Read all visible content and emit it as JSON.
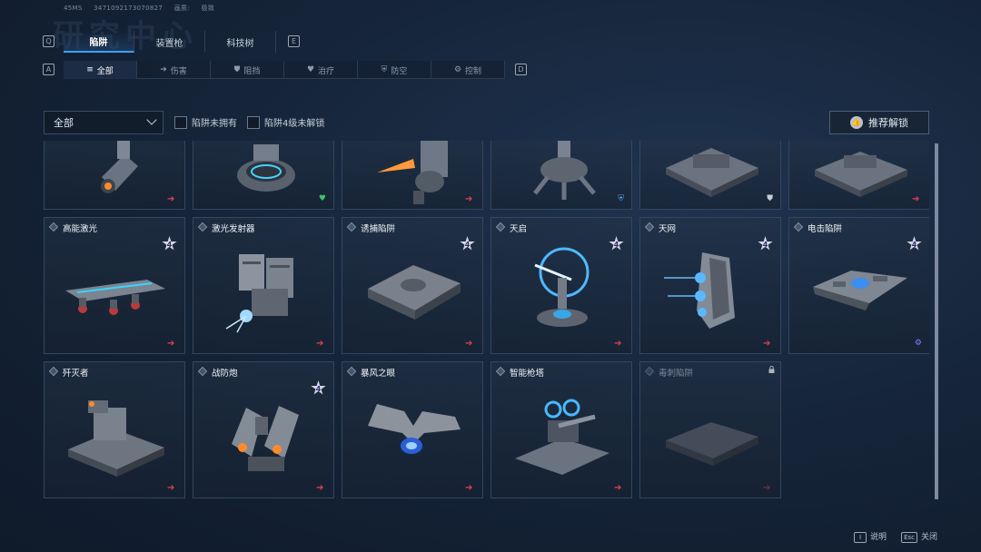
{
  "top_info": {
    "fps": "45MS",
    "uid": "3471092173070827",
    "quality_label": "画质:",
    "quality_value": "极致"
  },
  "background_title": "研究中心",
  "tabs_main": {
    "left_key": "Q",
    "right_key": "E",
    "items": [
      {
        "label": "陷阱",
        "active": true
      },
      {
        "label": "装置枪",
        "active": false
      },
      {
        "label": "科技树",
        "active": false
      }
    ]
  },
  "tabs_filter": {
    "left_key": "A",
    "right_key": "D",
    "items": [
      {
        "label": "全部",
        "icon": "list-icon",
        "glyph": "≡",
        "active": true
      },
      {
        "label": "伤害",
        "icon": "damage-icon",
        "glyph": "➔",
        "active": false
      },
      {
        "label": "阻挡",
        "icon": "block-icon",
        "glyph": "⛊",
        "active": false
      },
      {
        "label": "治疗",
        "icon": "heal-icon",
        "glyph": "♥",
        "active": false
      },
      {
        "label": "防空",
        "icon": "anti-air-icon",
        "glyph": "⛨",
        "active": false
      },
      {
        "label": "控制",
        "icon": "control-icon",
        "glyph": "⚙",
        "active": false
      }
    ]
  },
  "filters": {
    "dropdown_value": "全部",
    "checkbox_not_owned": "陷阱未拥有",
    "checkbox_level4_locked": "陷阱4级未解锁",
    "recommend_label": "推荐解锁"
  },
  "cards": [
    {
      "title": "",
      "category_icon": "damage-arrow-icon"
    },
    {
      "title": "",
      "category_icon": "heal-heart-icon"
    },
    {
      "title": "",
      "category_icon": "damage-arrow-icon"
    },
    {
      "title": "",
      "category_icon": "anti-air-shield-icon"
    },
    {
      "title": "",
      "category_icon": "block-shield-icon"
    },
    {
      "title": "",
      "category_icon": "damage-arrow-icon"
    },
    {
      "title": "高能激光",
      "level": "4",
      "category_icon": "damage-arrow-icon"
    },
    {
      "title": "激光发射器",
      "level": "",
      "category_icon": "damage-arrow-icon"
    },
    {
      "title": "诱捕陷阱",
      "level": "4",
      "category_icon": "damage-arrow-icon"
    },
    {
      "title": "天启",
      "level": "4",
      "category_icon": "damage-arrow-icon"
    },
    {
      "title": "天网",
      "level": "4",
      "category_icon": "damage-arrow-icon"
    },
    {
      "title": "电击陷阱",
      "level": "4",
      "category_icon": "control-gear-icon"
    },
    {
      "title": "歼灭者",
      "level": "",
      "category_icon": "damage-arrow-icon"
    },
    {
      "title": "战防炮",
      "level": "4",
      "category_icon": "damage-arrow-icon"
    },
    {
      "title": "暴风之眼",
      "level": "",
      "category_icon": "damage-arrow-icon"
    },
    {
      "title": "智能枪塔",
      "level": "",
      "category_icon": "damage-arrow-icon"
    },
    {
      "title": "毒刺陷阱",
      "level": "",
      "category_icon": "damage-arrow-icon",
      "locked": true
    }
  ],
  "footer": {
    "help_key": "I",
    "help_label": "说明",
    "close_key": "Esc",
    "close_label": "关闭"
  },
  "colors": {
    "accent": "#3aa0ff",
    "damage": "#e2414b",
    "heal": "#3cc46a",
    "anti_air": "#4fa3e0",
    "control": "#8a7bff"
  }
}
